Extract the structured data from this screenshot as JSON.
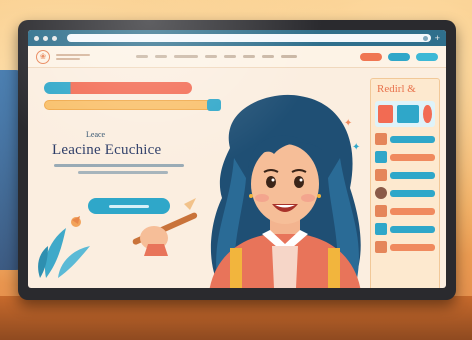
{
  "hero": {
    "kicker": "Leace",
    "title": "Leacine Ecuchice"
  },
  "sidebar": {
    "title": "Redirl &"
  },
  "colors": {
    "accent_blue": "#2fa7c9",
    "accent_orange": "#f26b53",
    "hair": "#1f4f74",
    "sweater": "#e8745a"
  }
}
